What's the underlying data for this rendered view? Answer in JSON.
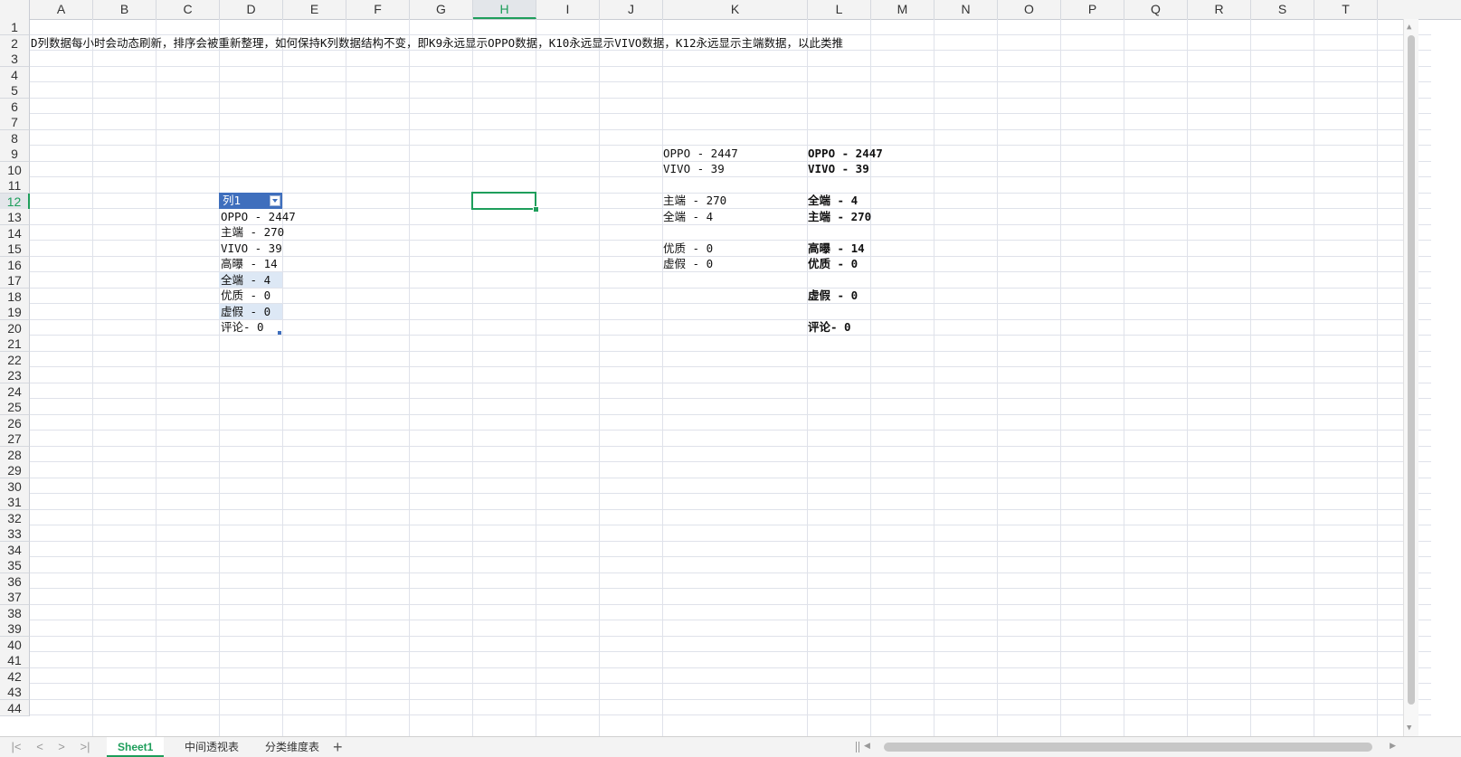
{
  "columns": [
    "A",
    "B",
    "C",
    "D",
    "E",
    "F",
    "G",
    "H",
    "I",
    "J",
    "K",
    "L",
    "M",
    "N",
    "O",
    "P",
    "Q",
    "R",
    "S",
    "T"
  ],
  "active_column": "H",
  "rows": [
    "1",
    "2",
    "3",
    "4",
    "5",
    "6",
    "7",
    "8",
    "9",
    "10",
    "11",
    "12",
    "13",
    "14",
    "15",
    "16",
    "17",
    "18",
    "19",
    "20",
    "21",
    "22",
    "23",
    "24",
    "25",
    "26",
    "27",
    "28",
    "29",
    "30",
    "31",
    "32",
    "33",
    "34",
    "35",
    "36",
    "37",
    "38",
    "39",
    "40",
    "41",
    "42",
    "43",
    "44"
  ],
  "active_row": "12",
  "note": "D列数据每小时会动态刷新，排序会被重新整理，如何保持K列数据结构不变，即K9永远显示OPPO数据，K10永远显示VIVO数据，K12永远显示主端数据，以此类推",
  "table_d": {
    "header": "列1",
    "rows": [
      "OPPO - 2447",
      "主端 - 270",
      "VIVO - 39",
      "高曝 - 14",
      "全端 - 4",
      "优质 - 0",
      "虚假 - 0",
      "评论- 0"
    ]
  },
  "column_k": {
    "r9": "OPPO - 2447",
    "r10": "VIVO - 39",
    "r12": "主端 - 270",
    "r13": "全端 - 4",
    "r15": "优质 - 0",
    "r16": "虚假 - 0"
  },
  "column_l": {
    "r9": "OPPO - 2447",
    "r10": "VIVO - 39",
    "r12": "全端 - 4",
    "r13": "主端 - 270",
    "r15": "高曝 - 14",
    "r16": "优质 - 0",
    "r18": "虚假 - 0",
    "r20": "评论- 0"
  },
  "sheet_tabs": [
    "Sheet1",
    "中间透视表",
    "分类维度表"
  ],
  "active_tab": "Sheet1",
  "add_tab_label": "+",
  "nav_icons": [
    "first-sheet-icon",
    "prev-sheet-icon",
    "next-sheet-icon",
    "last-sheet-icon"
  ],
  "colors": {
    "accent": "#1e9e5b",
    "table_header": "#3f6fbd",
    "table_band": "#dde8f5",
    "gridline": "#dfe2ea"
  }
}
